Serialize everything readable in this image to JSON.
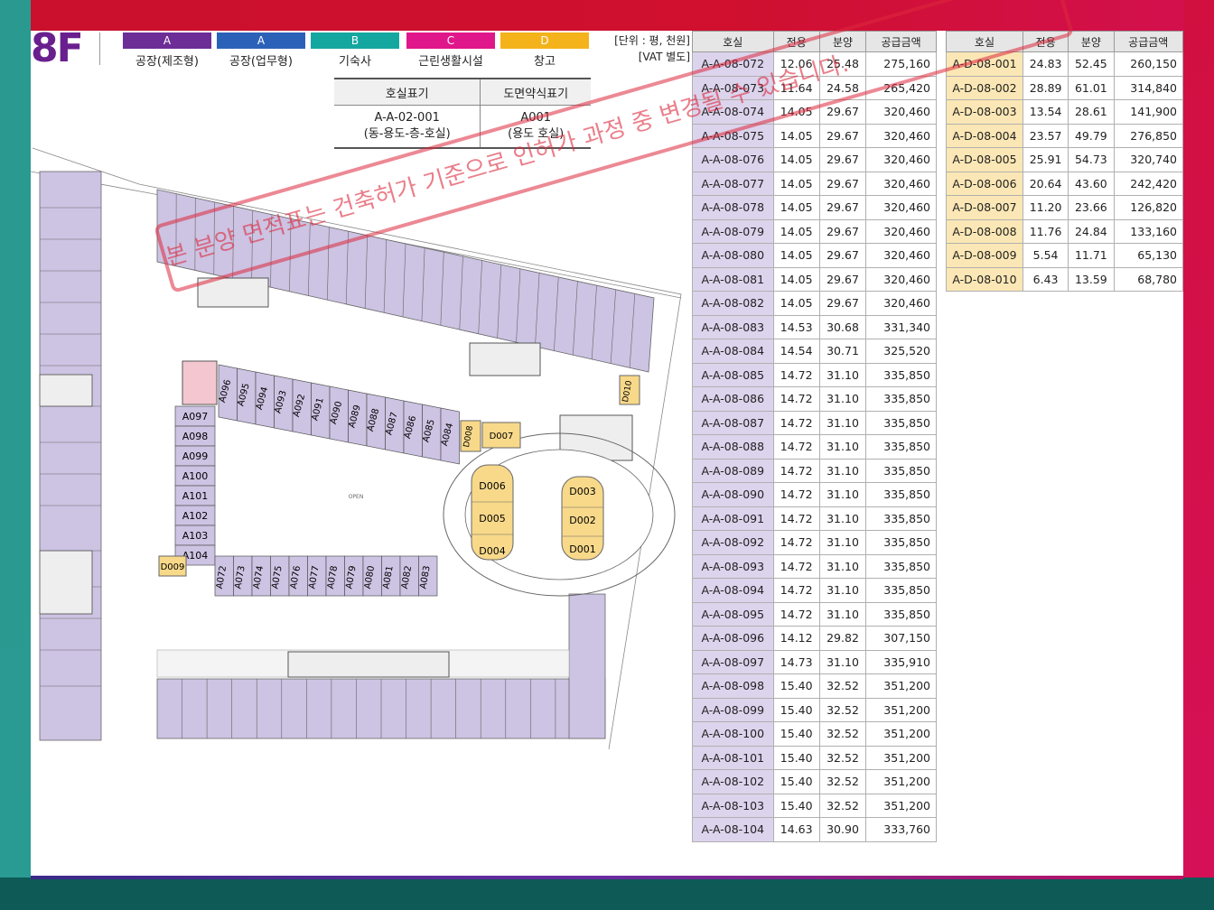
{
  "floor": "8F",
  "legend": [
    {
      "code": "A",
      "label": "공장(제조형)",
      "color": "#6d2d96"
    },
    {
      "code": "A",
      "label": "공장(업무형)",
      "color": "#2b62b8"
    },
    {
      "code": "B",
      "label": "기숙사",
      "color": "#14a7a0"
    },
    {
      "code": "C",
      "label": "근린생활시설",
      "color": "#e0178a"
    },
    {
      "code": "D",
      "label": "창고",
      "color": "#f4b21b"
    }
  ],
  "unit_note": {
    "line1": "[단위 : 평, 천원]",
    "line2": "[VAT 별도]"
  },
  "notation": {
    "headers": [
      "호실표기",
      "도면약식표기"
    ],
    "row1": [
      "A-A-02-001",
      "A001"
    ],
    "row2": [
      "(동-용도-층-호실)",
      "(용도 호실)"
    ]
  },
  "table_headers": [
    "호실",
    "전용",
    "분양",
    "공급금액"
  ],
  "table_a": [
    [
      "A-A-08-072",
      "12.06",
      "25.48",
      "275,160"
    ],
    [
      "A-A-08-073",
      "11.64",
      "24.58",
      "265,420"
    ],
    [
      "A-A-08-074",
      "14.05",
      "29.67",
      "320,460"
    ],
    [
      "A-A-08-075",
      "14.05",
      "29.67",
      "320,460"
    ],
    [
      "A-A-08-076",
      "14.05",
      "29.67",
      "320,460"
    ],
    [
      "A-A-08-077",
      "14.05",
      "29.67",
      "320,460"
    ],
    [
      "A-A-08-078",
      "14.05",
      "29.67",
      "320,460"
    ],
    [
      "A-A-08-079",
      "14.05",
      "29.67",
      "320,460"
    ],
    [
      "A-A-08-080",
      "14.05",
      "29.67",
      "320,460"
    ],
    [
      "A-A-08-081",
      "14.05",
      "29.67",
      "320,460"
    ],
    [
      "A-A-08-082",
      "14.05",
      "29.67",
      "320,460"
    ],
    [
      "A-A-08-083",
      "14.53",
      "30.68",
      "331,340"
    ],
    [
      "A-A-08-084",
      "14.54",
      "30.71",
      "325,520"
    ],
    [
      "A-A-08-085",
      "14.72",
      "31.10",
      "335,850"
    ],
    [
      "A-A-08-086",
      "14.72",
      "31.10",
      "335,850"
    ],
    [
      "A-A-08-087",
      "14.72",
      "31.10",
      "335,850"
    ],
    [
      "A-A-08-088",
      "14.72",
      "31.10",
      "335,850"
    ],
    [
      "A-A-08-089",
      "14.72",
      "31.10",
      "335,850"
    ],
    [
      "A-A-08-090",
      "14.72",
      "31.10",
      "335,850"
    ],
    [
      "A-A-08-091",
      "14.72",
      "31.10",
      "335,850"
    ],
    [
      "A-A-08-092",
      "14.72",
      "31.10",
      "335,850"
    ],
    [
      "A-A-08-093",
      "14.72",
      "31.10",
      "335,850"
    ],
    [
      "A-A-08-094",
      "14.72",
      "31.10",
      "335,850"
    ],
    [
      "A-A-08-095",
      "14.72",
      "31.10",
      "335,850"
    ],
    [
      "A-A-08-096",
      "14.12",
      "29.82",
      "307,150"
    ],
    [
      "A-A-08-097",
      "14.73",
      "31.10",
      "335,910"
    ],
    [
      "A-A-08-098",
      "15.40",
      "32.52",
      "351,200"
    ],
    [
      "A-A-08-099",
      "15.40",
      "32.52",
      "351,200"
    ],
    [
      "A-A-08-100",
      "15.40",
      "32.52",
      "351,200"
    ],
    [
      "A-A-08-101",
      "15.40",
      "32.52",
      "351,200"
    ],
    [
      "A-A-08-102",
      "15.40",
      "32.52",
      "351,200"
    ],
    [
      "A-A-08-103",
      "15.40",
      "32.52",
      "351,200"
    ],
    [
      "A-A-08-104",
      "14.63",
      "30.90",
      "333,760"
    ]
  ],
  "table_d": [
    [
      "A-D-08-001",
      "24.83",
      "52.45",
      "260,150"
    ],
    [
      "A-D-08-002",
      "28.89",
      "61.01",
      "314,840"
    ],
    [
      "A-D-08-003",
      "13.54",
      "28.61",
      "141,900"
    ],
    [
      "A-D-08-004",
      "23.57",
      "49.79",
      "276,850"
    ],
    [
      "A-D-08-005",
      "25.91",
      "54.73",
      "320,740"
    ],
    [
      "A-D-08-006",
      "20.64",
      "43.60",
      "242,420"
    ],
    [
      "A-D-08-007",
      "11.20",
      "23.66",
      "126,820"
    ],
    [
      "A-D-08-008",
      "11.76",
      "24.84",
      "133,160"
    ],
    [
      "A-D-08-009",
      "5.54",
      "11.71",
      "65,130"
    ],
    [
      "A-D-08-010",
      "6.43",
      "13.59",
      "68,780"
    ]
  ],
  "plan_labels": {
    "row_left": [
      "A097",
      "A098",
      "A099",
      "A100",
      "A101",
      "A102",
      "A103",
      "A104"
    ],
    "row_diag": [
      "A096",
      "A095",
      "A094",
      "A093",
      "A092",
      "A091",
      "A090",
      "A089",
      "A088",
      "A087",
      "A086",
      "A085",
      "A084"
    ],
    "row_bottom": [
      "A072",
      "A073",
      "A074",
      "A075",
      "A076",
      "A077",
      "A078",
      "A079",
      "A080",
      "A081",
      "A082",
      "A083"
    ],
    "d_left": [
      "D006",
      "D005",
      "D004"
    ],
    "d_right": [
      "D003",
      "D002",
      "D001"
    ],
    "d_misc": {
      "d007": "D007",
      "d008": "D008",
      "d009": "D009",
      "d010": "D010"
    },
    "open": "OPEN"
  },
  "watermark": "본 분양 면적표는 건축허가 기준으로 인허가 과정 중 변경될 수 있습니다.",
  "colors": {
    "a_cell": "#dcd3ec",
    "d_cell": "#fbe7b5",
    "unit_fill": "#cdc3e3",
    "d_fill": "#f8d98a"
  }
}
